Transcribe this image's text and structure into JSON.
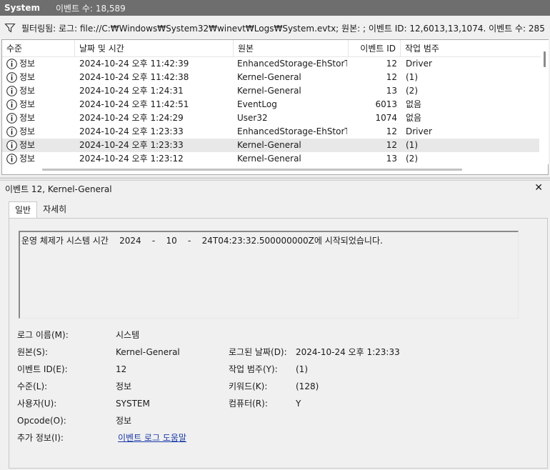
{
  "titlebar": {
    "title": "System",
    "count": "이벤트 수: 18,589"
  },
  "filter": {
    "text": "필터링됨: 로그: file://C:₩Windows₩System32₩winevt₩Logs₩System.evtx; 원본: ; 이벤트 ID: 12,6013,13,1074. 이벤트 수: 285"
  },
  "list": {
    "columns": [
      "수준",
      "날짜 및 시간",
      "원본",
      "이벤트 ID",
      "작업 범주"
    ],
    "rows": [
      {
        "level": "정보",
        "datetime": "2024-10-24 오후 11:42:39",
        "source": "EnhancedStorage-EhStorT...",
        "id": "12",
        "category": "Driver"
      },
      {
        "level": "정보",
        "datetime": "2024-10-24 오후 11:42:38",
        "source": "Kernel-General",
        "id": "12",
        "category": "(1)"
      },
      {
        "level": "정보",
        "datetime": "2024-10-24 오후 1:24:31",
        "source": "Kernel-General",
        "id": "13",
        "category": "(2)"
      },
      {
        "level": "정보",
        "datetime": "2024-10-24 오후 11:42:51",
        "source": "EventLog",
        "id": "6013",
        "category": "없음"
      },
      {
        "level": "정보",
        "datetime": "2024-10-24 오후 1:24:29",
        "source": "User32",
        "id": "1074",
        "category": "없음"
      },
      {
        "level": "정보",
        "datetime": "2024-10-24 오후 1:23:33",
        "source": "EnhancedStorage-EhStorT...",
        "id": "12",
        "category": "Driver"
      },
      {
        "level": "정보",
        "datetime": "2024-10-24 오후 1:23:33",
        "source": "Kernel-General",
        "id": "12",
        "category": "(1)"
      },
      {
        "level": "정보",
        "datetime": "2024-10-24 오후 1:23:12",
        "source": "Kernel-General",
        "id": "13",
        "category": "(2)"
      }
    ]
  },
  "detail": {
    "header": "이벤트 12, Kernel-General",
    "tabs": [
      "일반",
      "자세히"
    ],
    "description": "운영 체제가 시스템 시간    2024    -    10    -    24T04:23:32.500000000Z에 시작되었습니다.",
    "fields": {
      "log_name_label": "로그 이름(M):",
      "log_name": "시스템",
      "source_label": "원본(S):",
      "source": "Kernel-General",
      "logged_label": "로그된 날짜(D):",
      "logged": "2024-10-24 오후 1:23:33",
      "event_id_label": "이벤트 ID(E):",
      "event_id": "12",
      "task_label": "작업 범주(Y):",
      "task": "(1)",
      "level_label": "수준(L):",
      "level": "정보",
      "keywords_label": "키워드(K):",
      "keywords": "(128)",
      "user_label": "사용자(U):",
      "user": "SYSTEM",
      "computer_label": "컴퓨터(R):",
      "computer": "Y",
      "opcode_label": "Opcode(O):",
      "opcode": "정보",
      "more_info_label": "추가 정보(I):",
      "more_info_link": "이벤트 로그 도움말"
    }
  }
}
